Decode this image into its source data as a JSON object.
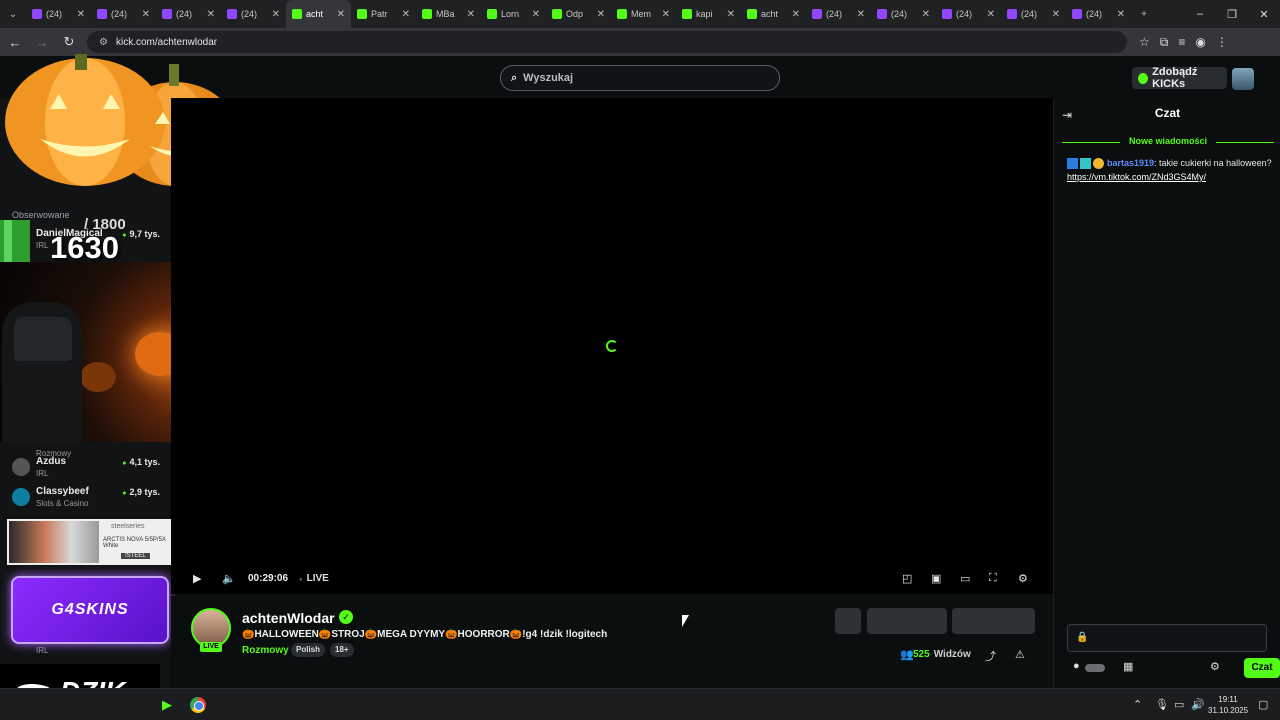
{
  "browser": {
    "tabs": [
      {
        "title": "(24)",
        "favicon": "twitch-icon",
        "active": false
      },
      {
        "title": "(24)",
        "favicon": "twitch-icon",
        "active": false
      },
      {
        "title": "(24)",
        "favicon": "twitch-icon",
        "active": false
      },
      {
        "title": "(24)",
        "favicon": "twitch-icon",
        "active": false
      },
      {
        "title": "acht",
        "favicon": "kick-icon",
        "active": true
      },
      {
        "title": "Patr",
        "favicon": "kick-icon",
        "active": false
      },
      {
        "title": "MBa",
        "favicon": "kick-icon",
        "active": false
      },
      {
        "title": "Lorn",
        "favicon": "kick-icon",
        "active": false
      },
      {
        "title": "Odp",
        "favicon": "kick-icon",
        "active": false
      },
      {
        "title": "Mem",
        "favicon": "kick-icon",
        "active": false
      },
      {
        "title": "kapi",
        "favicon": "kick-icon",
        "active": false
      },
      {
        "title": "acht",
        "favicon": "kick-icon",
        "active": false
      },
      {
        "title": "(24)",
        "favicon": "twitch-icon",
        "active": false
      },
      {
        "title": "(24)",
        "favicon": "twitch-icon",
        "active": false
      },
      {
        "title": "(24)",
        "favicon": "twitch-icon",
        "active": false
      },
      {
        "title": "(24)",
        "favicon": "twitch-icon",
        "active": false
      },
      {
        "title": "(24)",
        "favicon": "twitch-icon",
        "active": false
      }
    ],
    "url": "kick.com/achtenwlodar"
  },
  "header": {
    "search_placeholder": "Wyszukaj",
    "kicks_button": "Zdobądź KICKs"
  },
  "sidebar": {
    "followed_label": "Obserwowane",
    "rows_top": [
      {
        "name": "DanielMagical",
        "category": "IRL",
        "viewers": "9,7 tys."
      }
    ],
    "rows": [
      {
        "name": "",
        "category": "Rozmowy",
        "viewers": ""
      },
      {
        "name": "Azdus",
        "category": "IRL",
        "viewers": "4,1 tys."
      },
      {
        "name": "Classybeef",
        "category": "Slots & Casino",
        "viewers": "2,9 tys."
      },
      {
        "name": "",
        "category": "IRL",
        "viewers": ""
      }
    ]
  },
  "overlay": {
    "counter_current": "1630",
    "counter_max": "/ 1800",
    "ad_brand": "steelseries",
    "ad_product": "ARCTIS NOVA 5/5P/5X White",
    "ad_code": "!STEEL",
    "g4_label": "G4SKINS",
    "dzik_label": "DZIK"
  },
  "player": {
    "elapsed": "00:29:06",
    "live_label": "LIVE"
  },
  "stream": {
    "streamer": "achtenWlodar",
    "live_badge": "LIVE",
    "title": "🎃HALLOWEEN🎃STROJ🎃MEGA DYYMY🎃HOORROR🎃!g4 !dzik !logitech",
    "category": "Rozmowy",
    "tags": [
      "Polish",
      "18+"
    ],
    "viewers_count": "525",
    "viewers_label": "Widzów"
  },
  "chat": {
    "title": "Czat",
    "new_messages": "Nowe wiadomości",
    "messages": [
      {
        "user": "bartas1919",
        "text": ": takie cukierki na halloween? ",
        "link": "https://vm.tiktok.com/ZNd3GS4My/"
      }
    ],
    "send_label": "Czat"
  },
  "taskbar": {
    "time": "19:11",
    "date": "31.10.2025"
  },
  "colors": {
    "kick_green": "#53fc18",
    "twitch_purple": "#9146ff",
    "background": "#0b0e0f"
  }
}
